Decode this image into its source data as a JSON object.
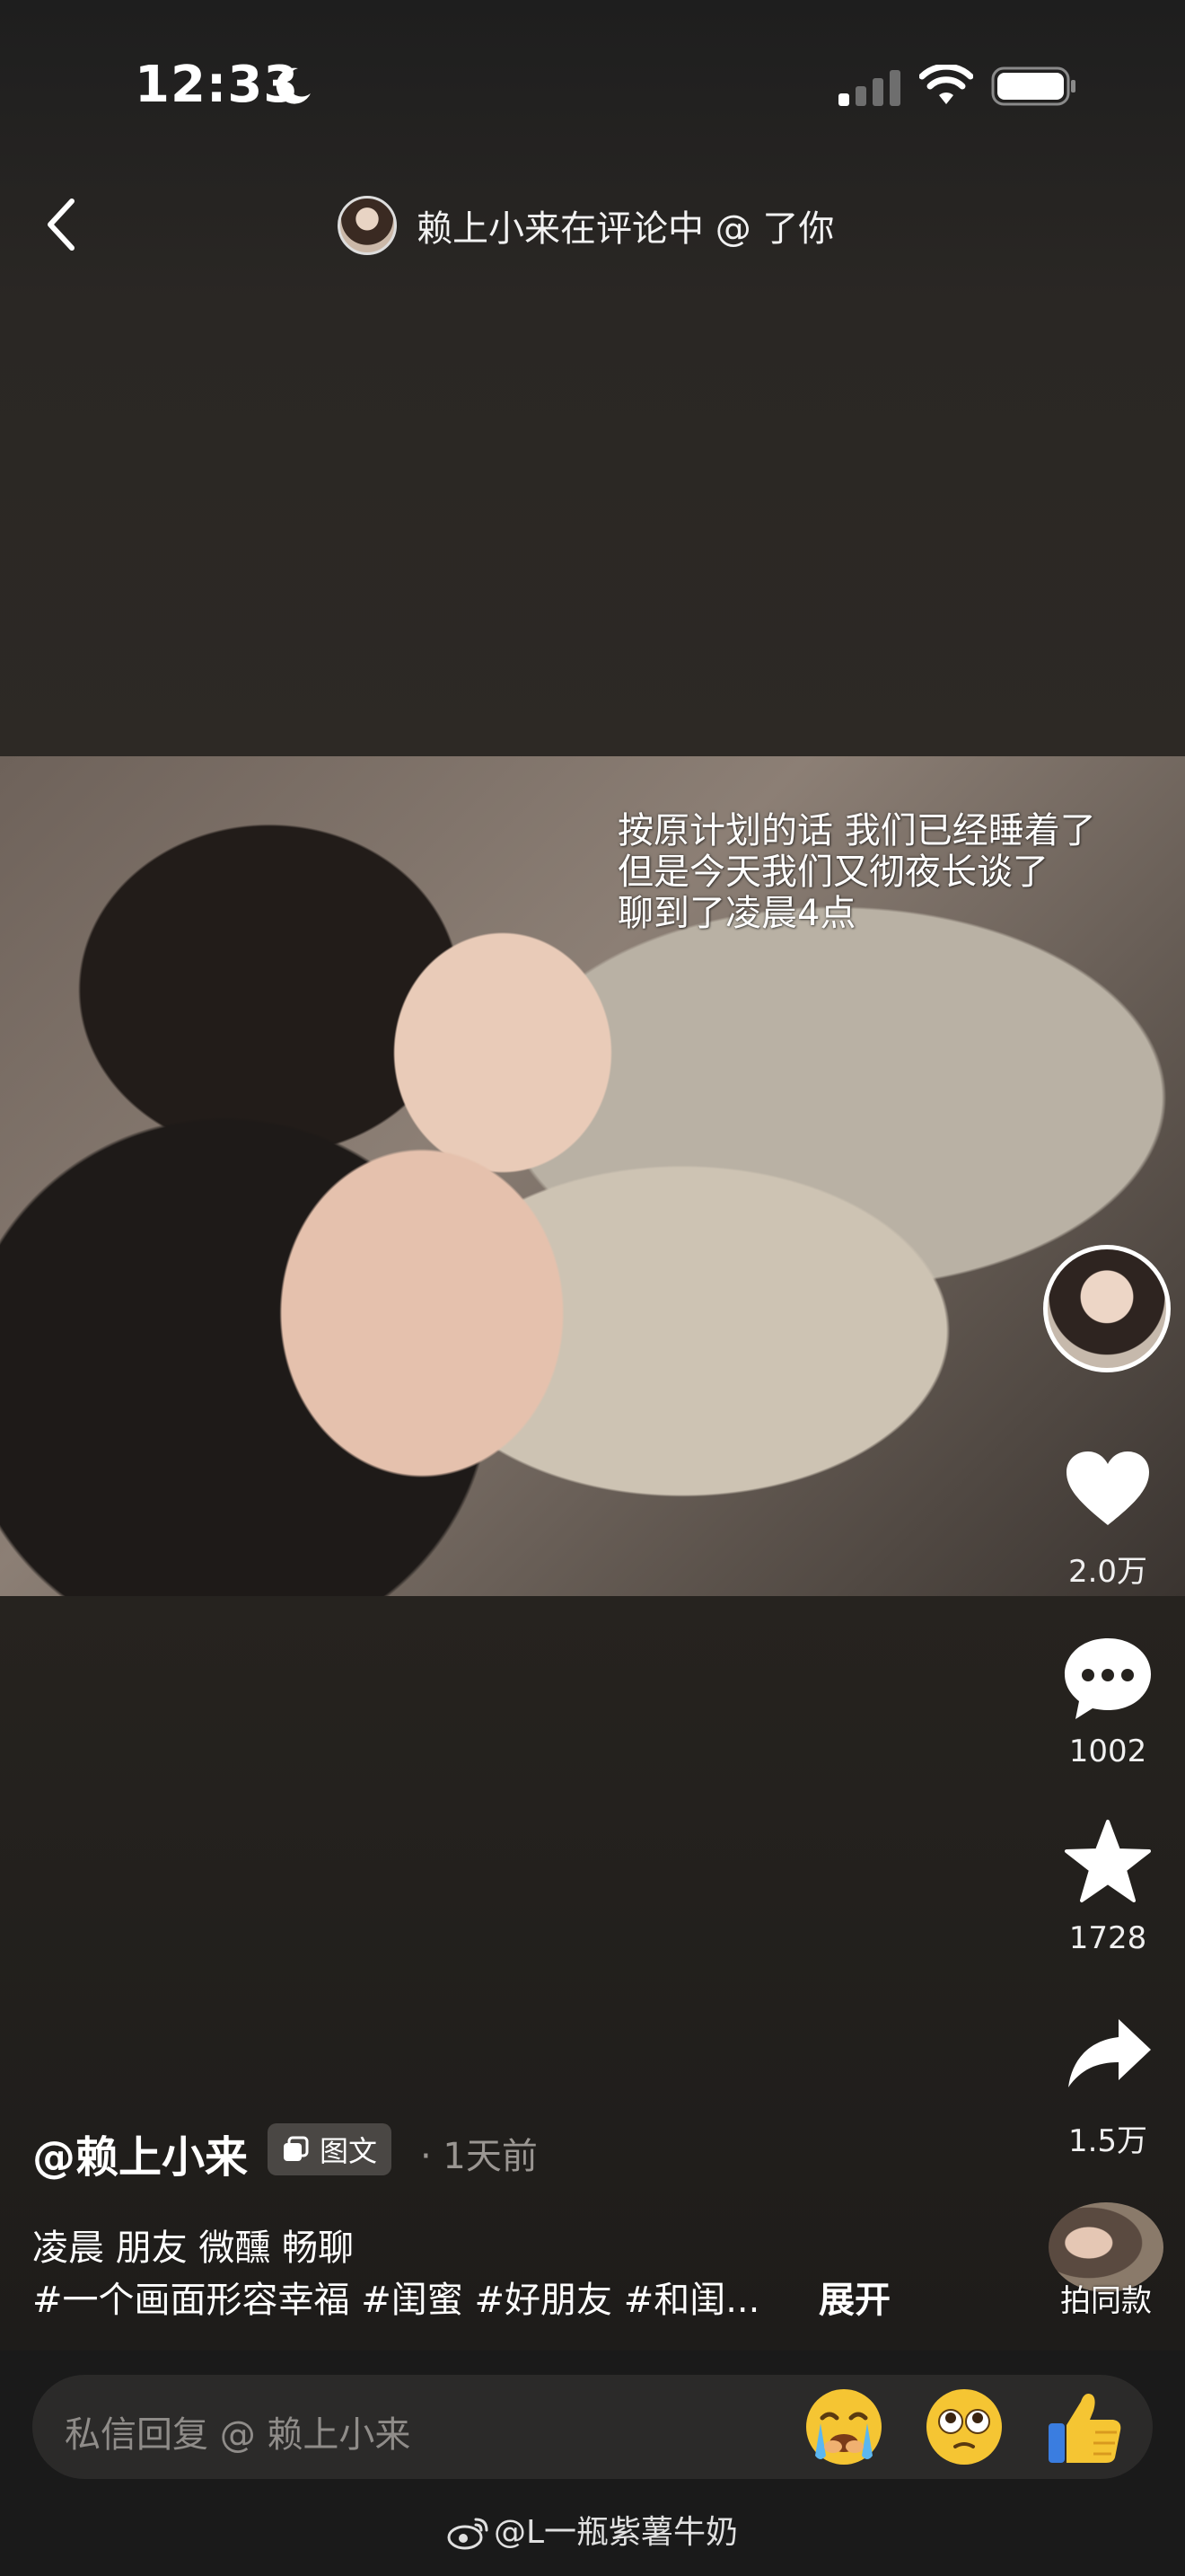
{
  "status_bar": {
    "time": "12:33"
  },
  "header": {
    "notice": "赖上小来在评论中 @ 了你"
  },
  "photo": {
    "caption_lines": [
      "按原计划的话 我们已经睡着了",
      "但是今天我们又彻夜长谈了",
      "聊到了凌晨4点"
    ]
  },
  "actions": {
    "likes": "2.0万",
    "comments": "1002",
    "favorites": "1728",
    "shares": "1.5万",
    "same_style": "拍同款"
  },
  "post": {
    "author": "@赖上小来",
    "type_badge": "图文",
    "time": "· 1天前",
    "tags_line": "凌晨 朋友 微醺 畅聊",
    "hashtags_line": "#一个画面形容幸福 #闺蜜 #好朋友 #和闺...",
    "expand": "展开"
  },
  "reply": {
    "placeholder": "私信回复 @ 赖上小来"
  },
  "watermark": "@L一瓶紫薯牛奶"
}
